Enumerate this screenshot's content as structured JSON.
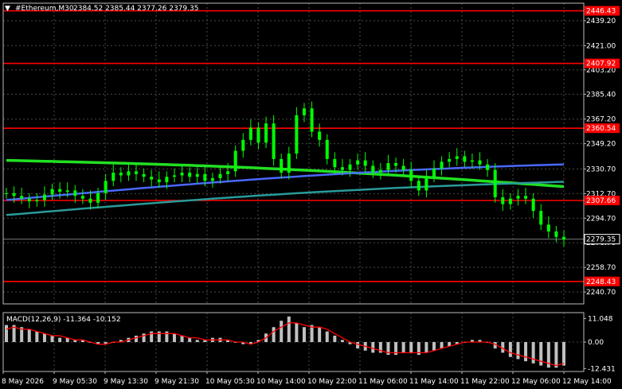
{
  "header": {
    "title": "#Ethereum,M30",
    "ohlc": "2384.52 2385.44 2377.26 2379.35"
  },
  "chart_data": [
    {
      "type": "candlestick",
      "symbol": "#Ethereum",
      "timeframe": "M30",
      "price_axis_ticks": [
        "2439.20",
        "2421.00",
        "2403.20",
        "2385.40",
        "2367.20",
        "2349.20",
        "2330.70",
        "2312.70",
        "2294.70",
        "2276.70",
        "2258.70",
        "2240.70"
      ],
      "ylim": [
        2232,
        2452
      ],
      "time_ticks": [
        "8 May 2026",
        "9 May 05:30",
        "9 May 13:30",
        "9 May 21:30",
        "10 May 05:30",
        "10 May 14:00",
        "10 May 22:00",
        "11 May 06:00",
        "11 May 14:00",
        "11 May 22:00",
        "12 May 06:00",
        "12 May 14:00"
      ],
      "close_prices": [
        2313,
        2311,
        2309,
        2307,
        2308,
        2312,
        2316,
        2314,
        2315,
        2311,
        2309,
        2306,
        2313,
        2322,
        2328,
        2326,
        2329,
        2327,
        2325,
        2323,
        2321,
        2325,
        2326,
        2328,
        2325,
        2327,
        2322,
        2324,
        2327,
        2329,
        2344,
        2352,
        2361,
        2350,
        2364,
        2338,
        2328,
        2342,
        2370,
        2375,
        2358,
        2352,
        2338,
        2332,
        2330,
        2334,
        2337,
        2333,
        2328,
        2330,
        2335,
        2333,
        2330,
        2322,
        2315,
        2325,
        2331,
        2336,
        2338,
        2340,
        2336,
        2337,
        2334,
        2330,
        2310,
        2305,
        2309,
        2311,
        2309,
        2300,
        2290,
        2285,
        2281,
        2279
      ],
      "current_price": 2279.35,
      "horizontal_levels": [
        2446.43,
        2407.92,
        2360.54,
        2307.66,
        2248.43
      ],
      "moving_averages": [
        {
          "start": 2337,
          "end": 2318,
          "color": "#22e022"
        },
        {
          "start": 2308,
          "end": 2330,
          "color": "#4a68ff"
        },
        {
          "start": 2297,
          "end": 2320,
          "color": "#2a9a9a"
        }
      ],
      "macd": {
        "label": "MACD(12,26,9) -11.364 -10.152",
        "axis_ticks": [
          "11.048",
          "0.00",
          "-12.431"
        ],
        "ylim": [
          -13.8,
          13.8
        ],
        "histogram": [
          8,
          8,
          7,
          6,
          5,
          4,
          3,
          2,
          2,
          1,
          1,
          0,
          -1,
          -1,
          0,
          1,
          2,
          3,
          4,
          5,
          5,
          5,
          4,
          3,
          2,
          1,
          1,
          2,
          2,
          1,
          0,
          -1,
          -1,
          1,
          4,
          7,
          10,
          12,
          9,
          7,
          8,
          7,
          5,
          3,
          1,
          -1,
          -3,
          -4,
          -5,
          -5,
          -6,
          -6,
          -5,
          -5,
          -6,
          -5,
          -4,
          -3,
          -2,
          -1,
          0,
          1,
          1,
          0,
          -3,
          -5,
          -7,
          -8,
          -9,
          -10,
          -11,
          -12,
          -12,
          -11
        ],
        "signal": [
          6,
          7,
          6,
          6,
          5,
          4,
          3,
          3,
          2,
          1,
          1,
          0,
          -1,
          -1,
          0,
          0,
          1,
          2,
          3,
          4,
          4,
          4,
          4,
          3,
          2,
          2,
          1,
          1,
          1,
          1,
          0,
          0,
          -1,
          0,
          2,
          5,
          7,
          9,
          9,
          8,
          7,
          7,
          6,
          4,
          2,
          0,
          -1,
          -2,
          -3,
          -4,
          -5,
          -5,
          -5,
          -5,
          -5,
          -5,
          -4,
          -3,
          -2,
          -1,
          0,
          0,
          0,
          0,
          -1,
          -3,
          -5,
          -6,
          -7,
          -8,
          -9,
          -10,
          -11,
          -10
        ]
      }
    }
  ],
  "colors": {
    "background": "#000000",
    "candle": "#00ff00",
    "level_line": "#ff0000",
    "price_tag": "#ff0000",
    "current_price_tag_border": "#ffffff",
    "grid": "#4a4a4a",
    "macd_histogram": "#c0c0c0",
    "macd_signal": "#ff0000"
  }
}
